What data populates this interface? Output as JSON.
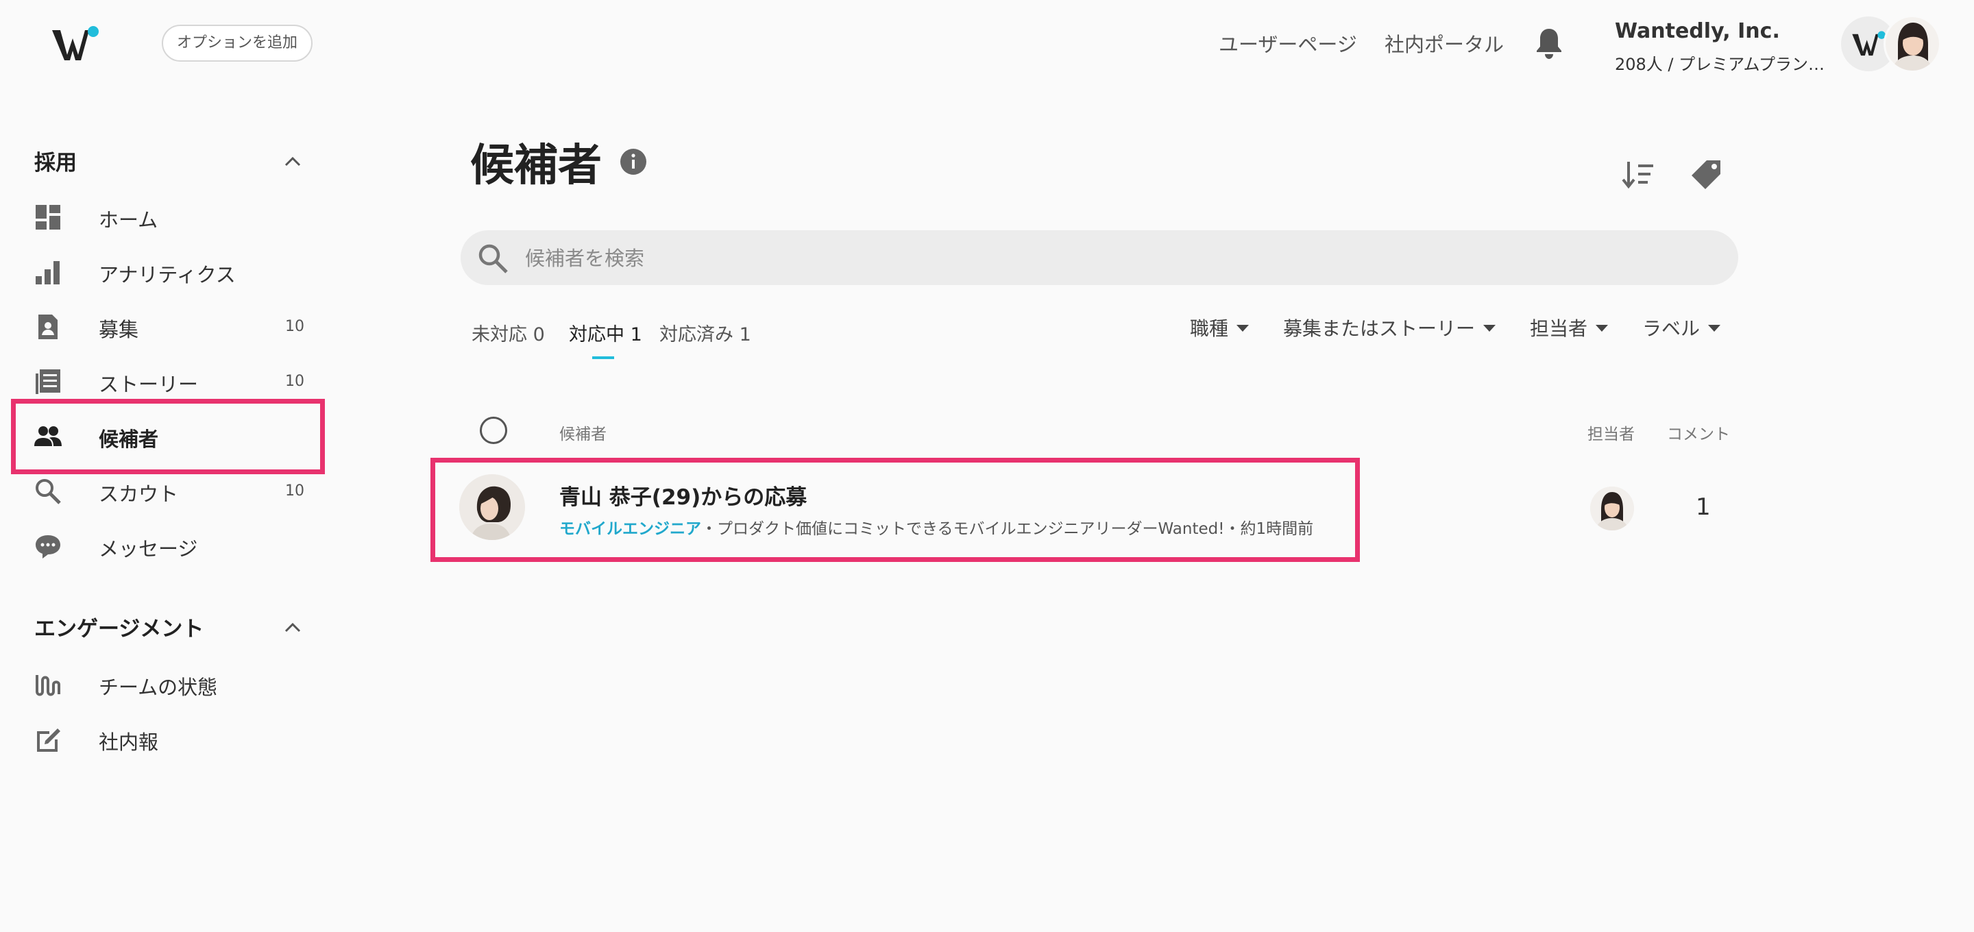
{
  "header": {
    "add_option_label": "オプションを追加",
    "user_page_label": "ユーザーページ",
    "portal_label": "社内ポータル",
    "company_name": "Wantedly, Inc.",
    "company_plan": "208人 / プレミアムプラン ..."
  },
  "sidebar": {
    "recruit_section": "採用",
    "recruit_items": [
      {
        "label": "ホーム",
        "count": "",
        "icon": "dashboard-icon"
      },
      {
        "label": "アナリティクス",
        "count": "",
        "icon": "bar-chart-icon"
      },
      {
        "label": "募集",
        "count": "10",
        "icon": "recruit-document-icon"
      },
      {
        "label": "ストーリー",
        "count": "10",
        "icon": "story-icon"
      },
      {
        "label": "候補者",
        "count": "",
        "icon": "people-icon"
      },
      {
        "label": "スカウト",
        "count": "10",
        "icon": "search-icon"
      },
      {
        "label": "メッセージ",
        "count": "",
        "icon": "chat-icon"
      }
    ],
    "engagement_section": "エンゲージメント",
    "engagement_items": [
      {
        "label": "チームの状態",
        "icon": "pulse-icon"
      },
      {
        "label": "社内報",
        "icon": "edit-icon"
      }
    ]
  },
  "main": {
    "title": "候補者",
    "search_placeholder": "候補者を検索",
    "tabs": [
      {
        "label": "未対応 0"
      },
      {
        "label": "対応中 1"
      },
      {
        "label": "対応済み 1"
      }
    ],
    "filters": [
      "職種",
      "募集またはストーリー",
      "担当者",
      "ラベル"
    ],
    "columns": {
      "candidate": "候補者",
      "assignee": "担当者",
      "comment": "コメント"
    },
    "candidates": [
      {
        "title": "青山 恭子(29)からの応募",
        "job": "モバイルエンジニア",
        "detail": "・プロダクト価値にコミットできるモバイルエンジニアリーダーWanted!・約1時間前",
        "comment_count": "1"
      }
    ]
  },
  "colors": {
    "accent": "#21bddb",
    "highlight": "#e8326e",
    "job_link": "#21a8cc"
  }
}
